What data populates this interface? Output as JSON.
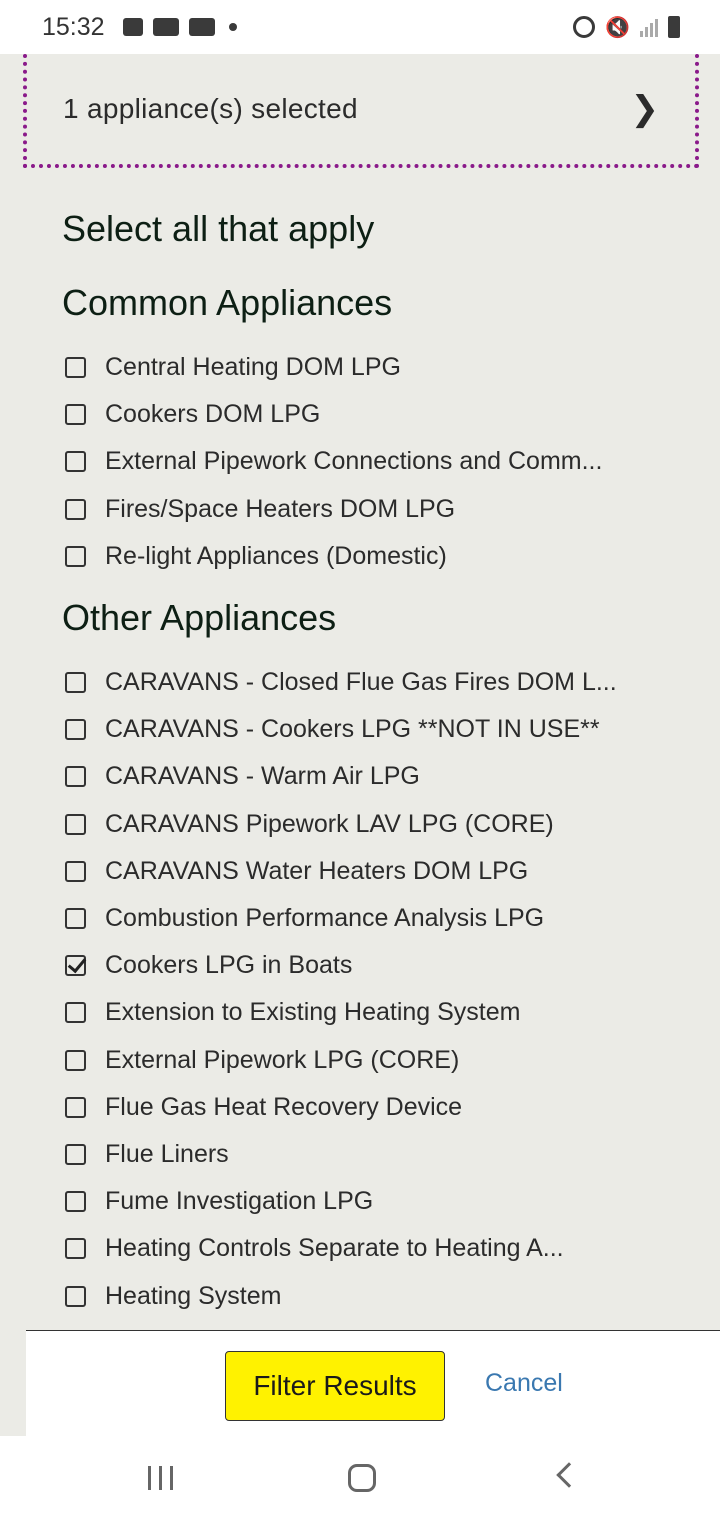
{
  "status_bar": {
    "time": "15:32"
  },
  "summary": {
    "text": "1 appliance(s) selected"
  },
  "prompt": "Select all that apply",
  "common": {
    "title": "Common Appliances",
    "items": [
      {
        "label": "Central Heating DOM LPG",
        "checked": false
      },
      {
        "label": "Cookers DOM LPG",
        "checked": false
      },
      {
        "label": "External Pipework Connections and Comm...",
        "checked": false
      },
      {
        "label": "Fires/Space Heaters DOM LPG",
        "checked": false
      },
      {
        "label": "Re-light Appliances (Domestic)",
        "checked": false
      }
    ]
  },
  "other": {
    "title": "Other Appliances",
    "items": [
      {
        "label": "CARAVANS - Closed Flue Gas Fires DOM L...",
        "checked": false
      },
      {
        "label": "CARAVANS - Cookers LPG **NOT IN USE**",
        "checked": false
      },
      {
        "label": "CARAVANS - Warm Air LPG",
        "checked": false
      },
      {
        "label": "CARAVANS Pipework LAV LPG (CORE)",
        "checked": false
      },
      {
        "label": "CARAVANS Water Heaters DOM LPG",
        "checked": false
      },
      {
        "label": "Combustion Performance Analysis LPG",
        "checked": false
      },
      {
        "label": "Cookers LPG in Boats",
        "checked": true
      },
      {
        "label": "Extension to Existing Heating System",
        "checked": false
      },
      {
        "label": "External Pipework LPG (CORE)",
        "checked": false
      },
      {
        "label": "Flue Gas Heat Recovery Device",
        "checked": false
      },
      {
        "label": "Flue Liners",
        "checked": false
      },
      {
        "label": "Fume Investigation LPG",
        "checked": false
      },
      {
        "label": "Heating Controls Separate to Heating A...",
        "checked": false
      },
      {
        "label": "Heating System",
        "checked": false
      }
    ]
  },
  "footer": {
    "filter_label": "Filter Results",
    "cancel_label": "Cancel"
  },
  "colors": {
    "page_bg": "#ebebe6",
    "summary_border": "#8a1a8a",
    "filter_button": "#fff200",
    "cancel_link": "#3a78b0"
  }
}
